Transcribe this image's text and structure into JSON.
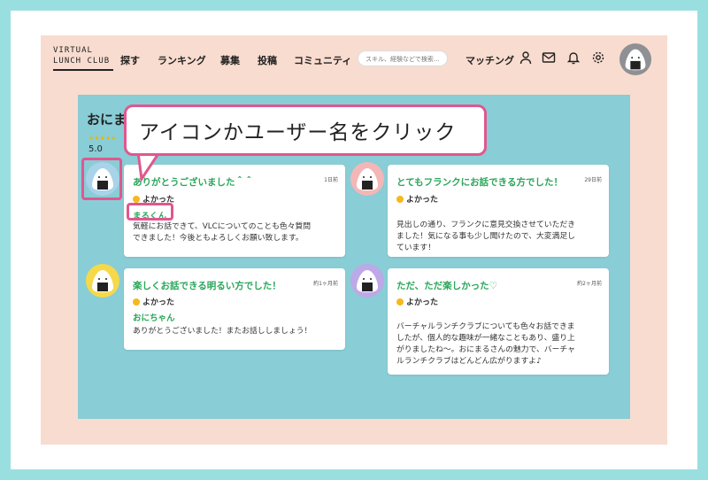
{
  "header": {
    "logo_line1": "VIRTUAL",
    "logo_line2": "LUNCH CLUB",
    "nav": [
      "探す",
      "ランキング",
      "募集",
      "投稿",
      "コミュニティ"
    ],
    "search_placeholder": "スキル、経験などで検索...",
    "matching": "マッチング",
    "icons": [
      "user-icon",
      "mail-icon",
      "bell-icon",
      "gear-icon"
    ]
  },
  "profile": {
    "name_partial": "おにま",
    "stars": "★★★★★",
    "score": "5.0"
  },
  "callout": "アイコンかユーザー名をクリック",
  "reviews": [
    {
      "title": "ありがとうございました＾＾",
      "time": "1日前",
      "mood": "よかった",
      "user": "まるくん",
      "body": [
        "気軽にお話できて、VLCについてのことも色々質問",
        "できました！今後ともよろしくお願い致します。"
      ]
    },
    {
      "title": "とてもフランクにお話できる方でした！",
      "time": "29日前",
      "mood": "よかった",
      "user": "",
      "body": [
        "見出しの通り、フランクに意見交換させていただき",
        "ました！気になる事も少し聞けたので、大変満足し",
        "ています！"
      ]
    },
    {
      "title": "楽しくお話できる明るい方でした！",
      "time": "約1ヶ月前",
      "mood": "よかった",
      "user": "おにちゃん",
      "body": [
        "ありがとうございました！またお話ししましょう！"
      ]
    },
    {
      "title": "ただ、ただ楽しかった♡",
      "time": "約2ヶ月前",
      "mood": "よかった",
      "user": "",
      "body": [
        "バーチャルランチクラブについても色々お話できま",
        "したが、個人的な趣味が一緒なこともあり、盛り上",
        "がりましたね〜。おにまるさんの魅力で、バーチャ",
        "ルランチクラブはどんどん広がりますよ♪"
      ]
    }
  ],
  "avatar_badge": "VLC",
  "colors": {
    "accent_pink": "#e0578f",
    "green": "#2aa65a",
    "panel": "#89cdd6",
    "page": "#f8dccf"
  }
}
